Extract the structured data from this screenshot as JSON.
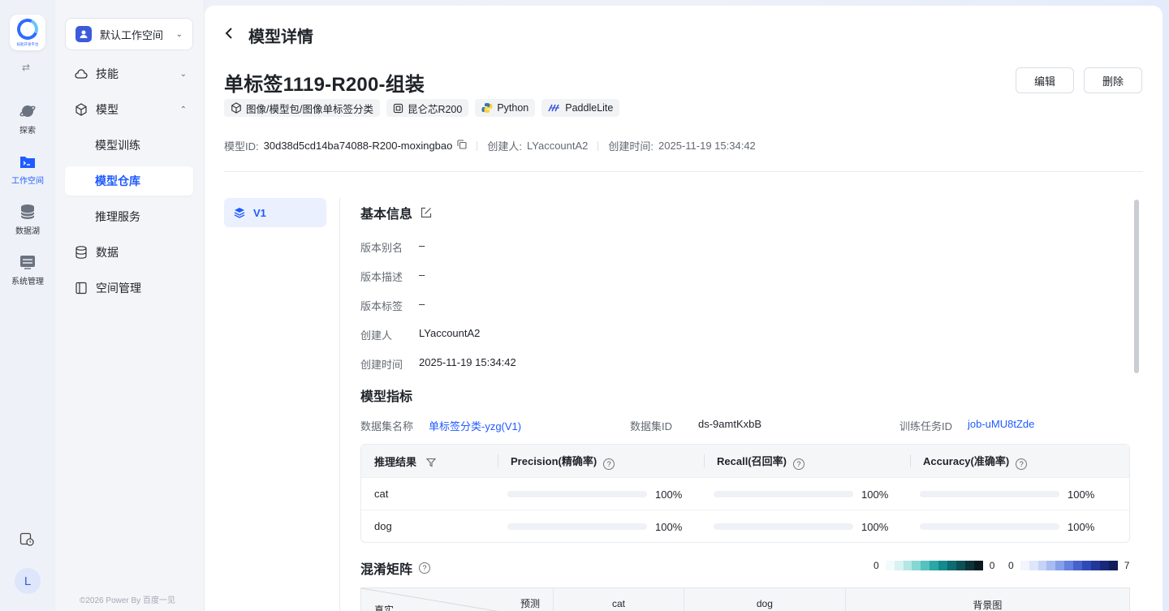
{
  "rail": {
    "logo_caption": "技能开发平台",
    "items": [
      {
        "label": "探索",
        "icon": "planet-icon"
      },
      {
        "label": "工作空间",
        "icon": "terminal-folder-icon"
      },
      {
        "label": "数据湖",
        "icon": "database-icon"
      },
      {
        "label": "系统管理",
        "icon": "server-icon"
      }
    ],
    "avatar": "L"
  },
  "sidebar": {
    "workspace": "默认工作空间",
    "nav": [
      {
        "label": "技能"
      },
      {
        "label": "模型"
      },
      {
        "label": "模型训练"
      },
      {
        "label": "模型仓库"
      },
      {
        "label": "推理服务"
      },
      {
        "label": "数据"
      },
      {
        "label": "空间管理"
      }
    ],
    "copyright": "©2026 Power By 百度一见"
  },
  "header": {
    "page_title": "模型详情",
    "model_name": "单标签1119-R200-组装",
    "edit_label": "编辑",
    "delete_label": "删除",
    "tags": [
      "图像/模型包/图像单标签分类",
      "昆仑芯R200",
      "Python",
      "PaddleLite"
    ]
  },
  "meta": {
    "id_label": "模型ID:",
    "id_value": "30d38d5cd14ba74088-R200-moxingbao",
    "creator_label": "创建人:",
    "creator_value": "LYaccountA2",
    "created_label": "创建时间:",
    "created_value": "2025-11-19 15:34:42"
  },
  "version": {
    "label": "V1"
  },
  "basic": {
    "title": "基本信息",
    "rows": [
      {
        "k": "版本别名",
        "v": "–"
      },
      {
        "k": "版本描述",
        "v": "–"
      },
      {
        "k": "版本标签",
        "v": "–"
      },
      {
        "k": "创建人",
        "v": "LYaccountA2"
      },
      {
        "k": "创建时间",
        "v": "2025-11-19 15:34:42"
      }
    ]
  },
  "metrics": {
    "title": "模型指标",
    "dataset_name_label": "数据集名称",
    "dataset_name": "单标签分类-yzg(V1)",
    "dataset_id_label": "数据集ID",
    "dataset_id": "ds-9amtKxbB",
    "job_id_label": "训练任务ID",
    "job_id": "job-uMU8tZde",
    "columns": [
      "推理结果",
      "Precision(精确率)",
      "Recall(召回率)",
      "Accuracy(准确率)"
    ],
    "rows": [
      {
        "label": "cat",
        "precision": 100,
        "recall": 100,
        "accuracy": 100,
        "precision_text": "100%",
        "recall_text": "100%",
        "accuracy_text": "100%"
      },
      {
        "label": "dog",
        "precision": 100,
        "recall": 100,
        "accuracy": 100,
        "precision_text": "100%",
        "recall_text": "100%",
        "accuracy_text": "100%"
      }
    ],
    "bar_color": "#1f5bff"
  },
  "confusion": {
    "title": "混淆矩阵",
    "legend1_min": "0",
    "legend1_max": "0",
    "legend2_min": "0",
    "legend2_max": "7",
    "pred_label": "预测",
    "true_label": "真实",
    "columns": [
      "cat",
      "dog",
      "背景图"
    ]
  }
}
